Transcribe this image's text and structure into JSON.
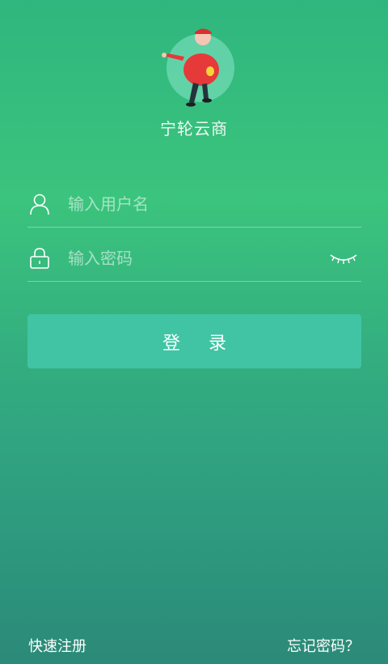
{
  "app": {
    "title": "宁轮云商"
  },
  "login_form": {
    "username_placeholder": "输入用户名",
    "username_value": "",
    "password_placeholder": "输入密码",
    "password_value": "",
    "submit_label": "登 录"
  },
  "footer": {
    "register_label": "快速注册",
    "forgot_label": "忘记密码？"
  },
  "icons": {
    "logo": "mascot-logo",
    "username": "user-icon",
    "password": "lock-icon",
    "toggle": "eye-closed-icon"
  },
  "colors": {
    "background_top": "#2fb67e",
    "background_bottom": "#2b8a78",
    "button": "#41c4a4",
    "text": "#ffffff"
  }
}
